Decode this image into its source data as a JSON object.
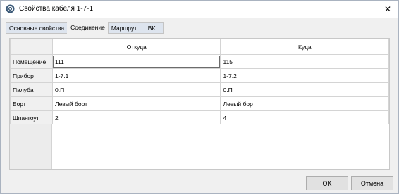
{
  "window": {
    "title": "Свойства кабеля 1-7-1",
    "close_glyph": "✕"
  },
  "tabs": [
    {
      "label": "Основные свойства",
      "active": false
    },
    {
      "label": "Соединение",
      "active": true
    },
    {
      "label": "Маршрут",
      "active": false
    },
    {
      "label": "ВК",
      "active": false
    }
  ],
  "grid": {
    "columns": [
      "",
      "Откуда",
      "Куда"
    ],
    "rows": [
      {
        "label": "Помещение",
        "from": "111",
        "to": "115"
      },
      {
        "label": "Прибор",
        "from": "1-7.1",
        "to": "1-7.2"
      },
      {
        "label": "Палуба",
        "from": "0.П",
        "to": "0.П"
      },
      {
        "label": "Борт",
        "from": "Левый борт",
        "to": "Левый борт"
      },
      {
        "label": "Шпангоут",
        "from": "2",
        "to": "4"
      }
    ]
  },
  "buttons": {
    "ok": "OK",
    "cancel": "Отмена"
  },
  "colors": {
    "tab_inactive": "#dde4ee",
    "window_bg": "#f0f0f0"
  }
}
